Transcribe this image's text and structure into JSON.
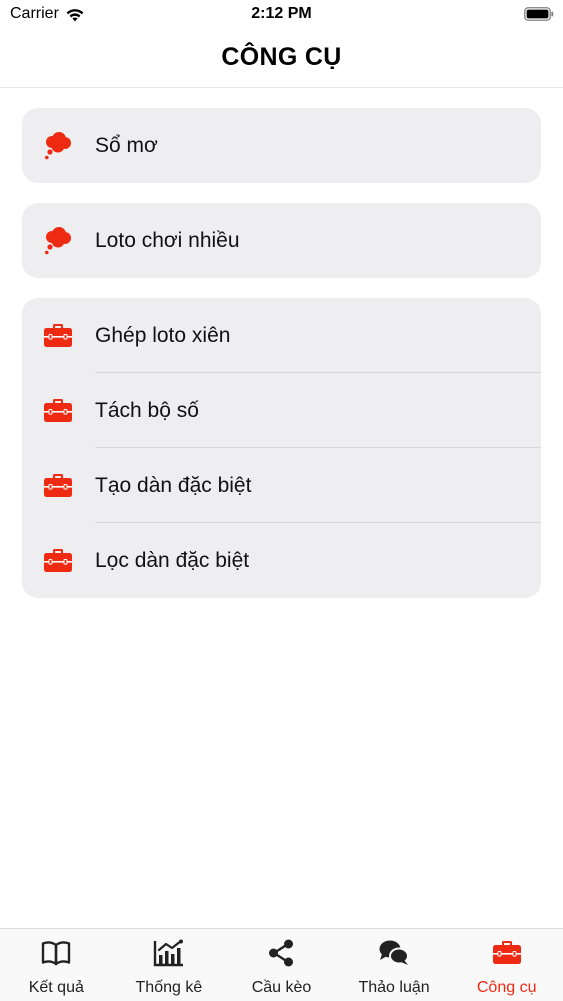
{
  "status_bar": {
    "carrier": "Carrier",
    "time": "2:12 PM"
  },
  "header": {
    "title": "CÔNG CỤ"
  },
  "groups": [
    {
      "items": [
        {
          "label": "Sổ mơ",
          "icon": "thought-bubble-icon"
        }
      ]
    },
    {
      "items": [
        {
          "label": "Loto chơi nhiều",
          "icon": "thought-bubble-icon"
        }
      ]
    },
    {
      "items": [
        {
          "label": "Ghép loto xiên",
          "icon": "toolbox-icon"
        },
        {
          "label": "Tách bộ số",
          "icon": "toolbox-icon"
        },
        {
          "label": "Tạo dàn đặc biệt",
          "icon": "toolbox-icon"
        },
        {
          "label": "Lọc dàn đặc biệt",
          "icon": "toolbox-icon"
        }
      ]
    }
  ],
  "tab_bar": {
    "active_index": 4,
    "tabs": [
      {
        "label": "Kết quả",
        "icon": "book-icon"
      },
      {
        "label": "Thống kê",
        "icon": "chart-icon"
      },
      {
        "label": "Cầu kèo",
        "icon": "share-icon"
      },
      {
        "label": "Thảo luận",
        "icon": "chat-bubbles-icon"
      },
      {
        "label": "Công cụ",
        "icon": "toolbox-icon"
      }
    ]
  },
  "colors": {
    "accent": "#ee2a12",
    "card_background": "#eeeef0",
    "tab_inactive": "#222222"
  }
}
